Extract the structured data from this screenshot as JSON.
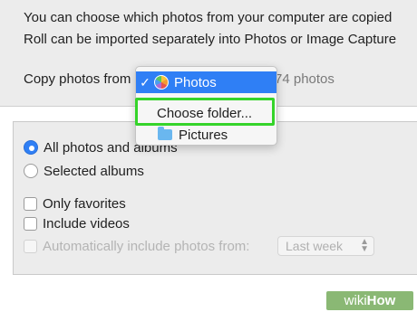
{
  "header": {
    "description_line1": "You can choose which photos from your computer are copied",
    "description_line2": "Roll can be imported separately into Photos or Image Capture",
    "copy_from_label": "Copy photos from",
    "photo_count": "74 photos"
  },
  "dropdown_menu": {
    "selected": {
      "check": "✓",
      "label": "Photos",
      "icon": "photos-app-icon"
    },
    "items": [
      {
        "label": "Choose folder...",
        "highlighted": true
      },
      {
        "label": "Pictures",
        "icon": "folder-icon"
      }
    ]
  },
  "options": {
    "radios": [
      {
        "label": "All photos and albums",
        "checked": true
      },
      {
        "label": "Selected albums",
        "checked": false
      }
    ],
    "checkboxes": [
      {
        "label": "Only favorites",
        "checked": false,
        "enabled": true
      },
      {
        "label": "Include videos",
        "checked": false,
        "enabled": true
      },
      {
        "label": "Automatically include photos from:",
        "checked": false,
        "enabled": false
      }
    ],
    "auto_include_select": {
      "value": "Last week",
      "enabled": false
    }
  },
  "watermark": {
    "part1": "wiki",
    "part2": "How"
  },
  "colors": {
    "accent": "#2f7ff5",
    "highlight_box": "#35d42a",
    "watermark_bg": "#8ab874"
  }
}
